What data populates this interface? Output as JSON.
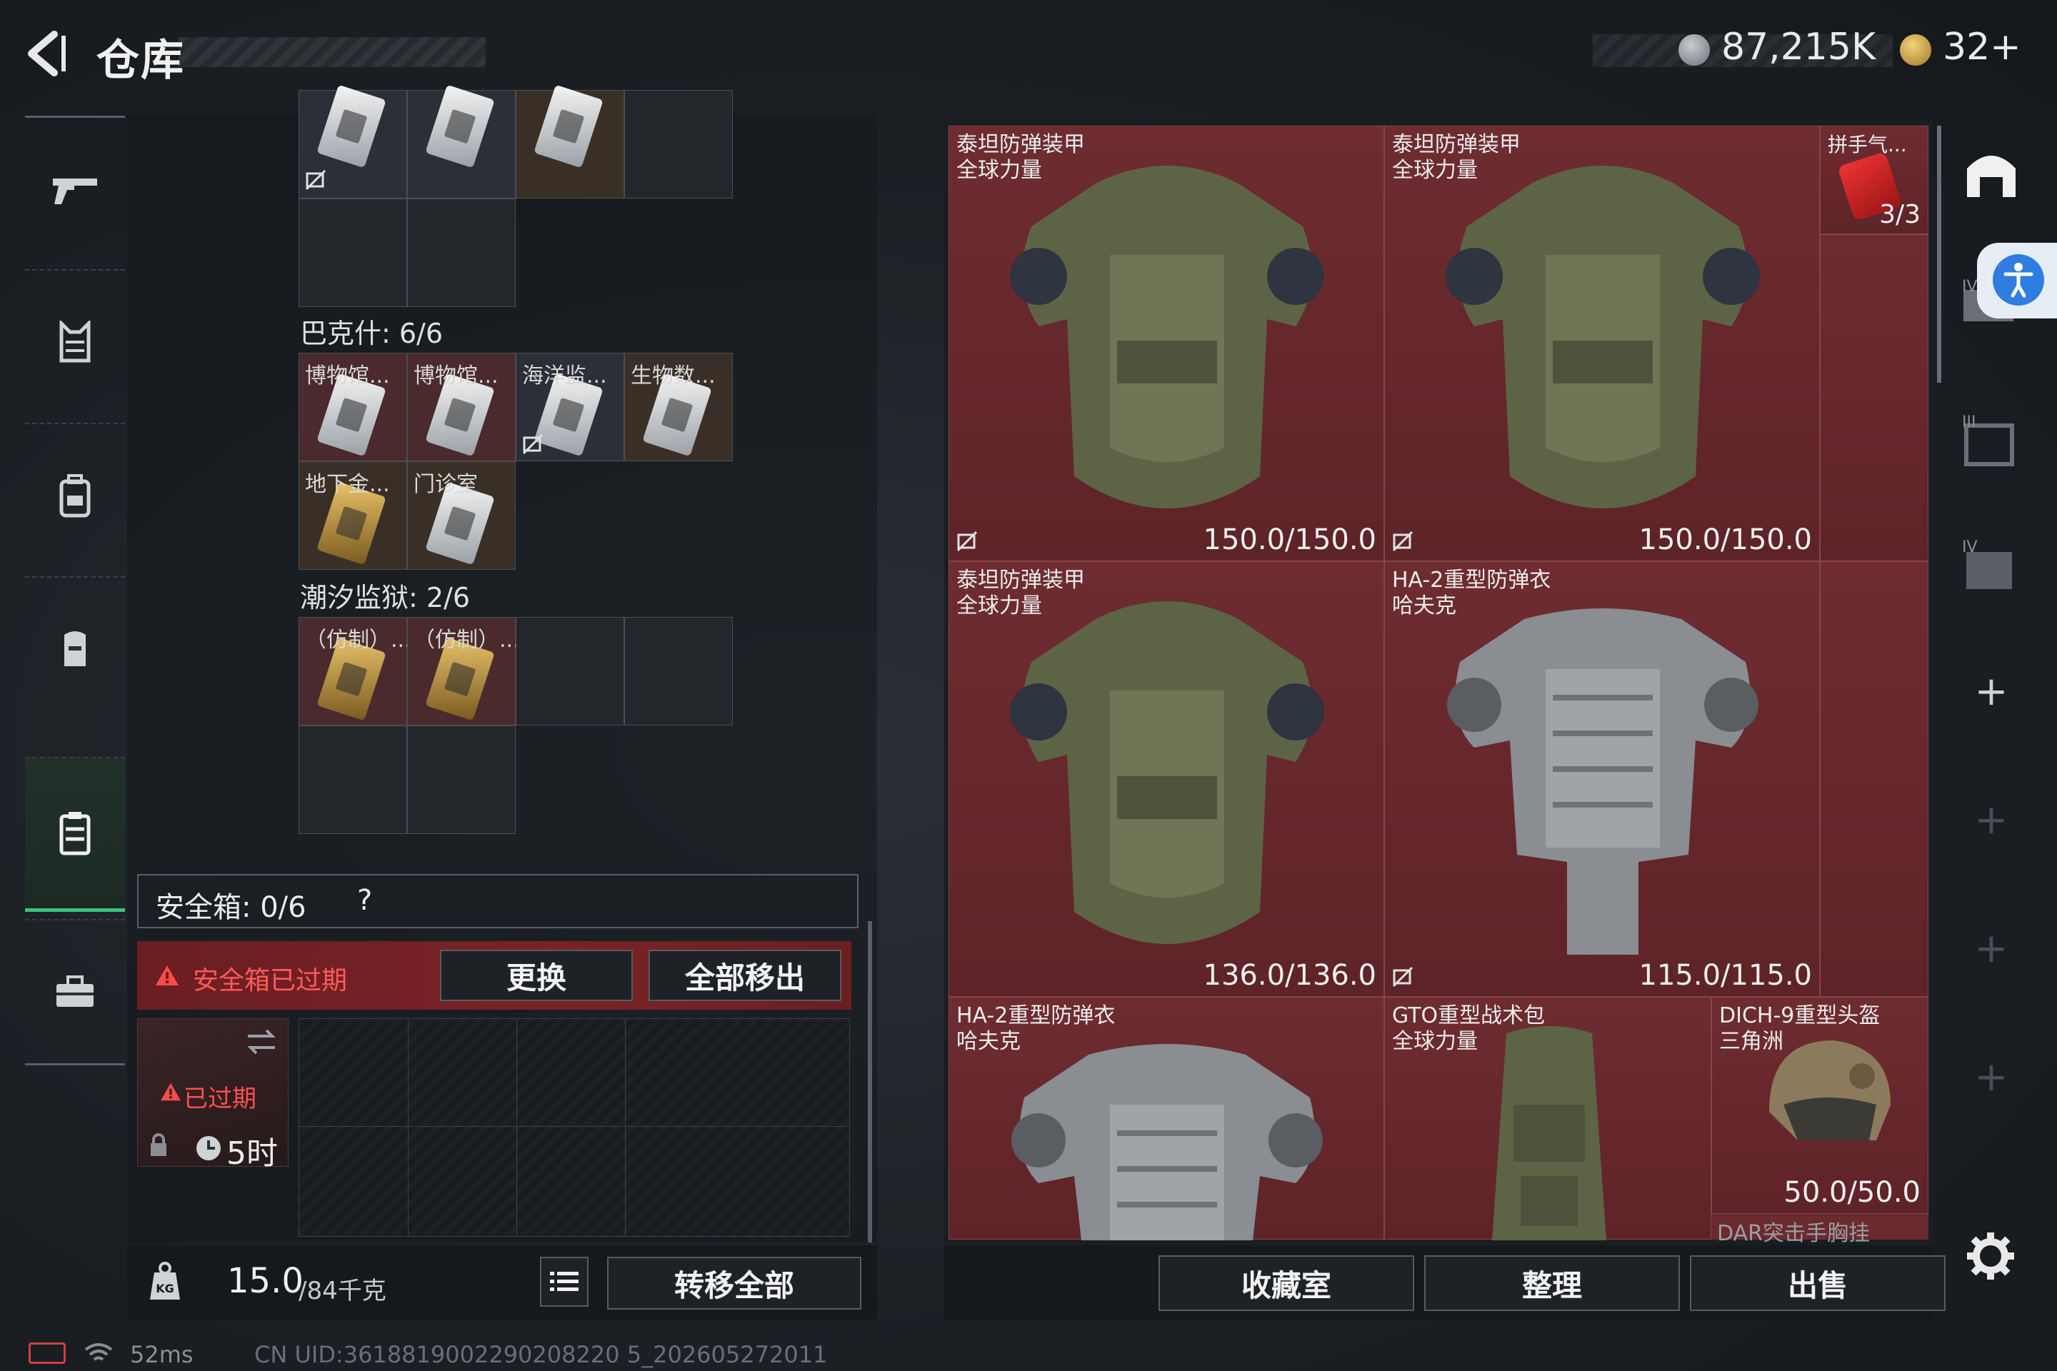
{
  "header": {
    "title": "仓库",
    "currency_amount": "87,215K",
    "currency2_amount": "32+"
  },
  "left_nav": {
    "items": [
      "weapon",
      "armor-vest",
      "backpack",
      "chest-rig",
      "safe-box",
      "case"
    ],
    "active_index": 4
  },
  "key_sections": [
    {
      "label": "巴克什: 6/6",
      "items": [
        {
          "label": "博物馆...",
          "color": "silver"
        },
        {
          "label": "博物馆...",
          "color": "silver"
        },
        {
          "label": "海洋监...",
          "color": "silver"
        },
        {
          "label": "生物数...",
          "color": "silver"
        },
        {
          "label": "地下金...",
          "color": "gold"
        },
        {
          "label": "门诊室",
          "color": "silver"
        }
      ]
    },
    {
      "label": "潮汐监狱: 2/6",
      "items": [
        {
          "label": "（仿制）...",
          "color": "gold"
        },
        {
          "label": "（仿制）...",
          "color": "gold"
        }
      ]
    }
  ],
  "safe_box": {
    "label": "安全箱: 0/6",
    "help": "?",
    "expired_notice": "安全箱已过期",
    "replace_button": "更换",
    "move_all_button": "全部移出",
    "expired_tag": "已过期",
    "time_remaining": "5时"
  },
  "footer_left": {
    "weight_value": "15.0",
    "weight_max": "/84千克",
    "transfer_all_button": "转移全部"
  },
  "inventory": {
    "items": [
      {
        "name": "泰坦防弹装甲",
        "brand": "全球力量",
        "durability": "150.0/150.0",
        "type": "titan"
      },
      {
        "name": "泰坦防弹装甲",
        "brand": "全球力量",
        "durability": "150.0/150.0",
        "type": "titan"
      },
      {
        "name": "拼手气...",
        "brand": "",
        "durability": "3/3",
        "type": "redpacket"
      },
      {
        "name": "泰坦防弹装甲",
        "brand": "全球力量",
        "durability": "136.0/136.0",
        "type": "titan"
      },
      {
        "name": "HA-2重型防弹衣",
        "brand": "哈夫克",
        "durability": "115.0/115.0",
        "type": "ha2"
      },
      {
        "name": "HA-2重型防弹衣",
        "brand": "哈夫克",
        "durability": "",
        "type": "ha2"
      },
      {
        "name": "GTO重型战术包",
        "brand": "全球力量",
        "durability": "",
        "type": "bag"
      },
      {
        "name": "DICH-9重型头盔",
        "brand": "三角洲",
        "durability": "50.0/50.0",
        "type": "helmet"
      }
    ],
    "partial_next_label": "DAR突击手胸挂"
  },
  "bottom_buttons": {
    "collection": "收藏室",
    "organize": "整理",
    "sell": "出售"
  },
  "status": {
    "ping": "52ms",
    "uid": "CN UID:3618819002290208220 5_202605272011"
  },
  "colors": {
    "accent_green": "#3ec27a",
    "inventory_red": "#6a2a2f",
    "expired_red": "#e24040",
    "accessibility_blue": "#2f7de0"
  }
}
